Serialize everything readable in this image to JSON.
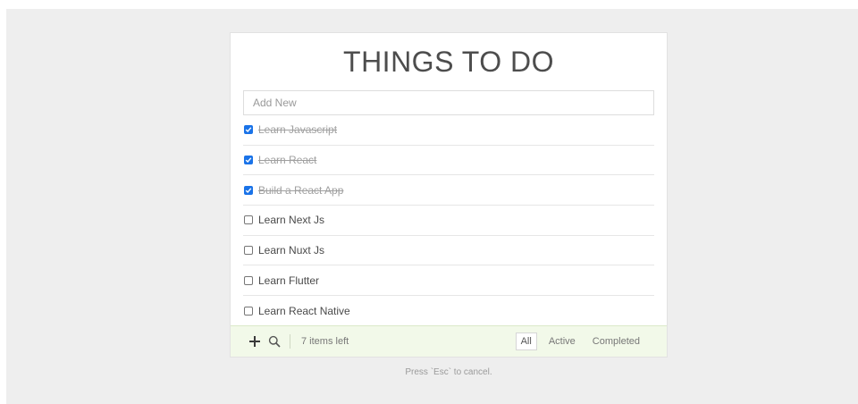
{
  "app": {
    "title": "THINGS TO DO"
  },
  "add_input": {
    "placeholder": "Add New",
    "value": ""
  },
  "todos": [
    {
      "label": "Learn Javascript",
      "completed": true
    },
    {
      "label": "Learn React",
      "completed": true
    },
    {
      "label": "Build a React App",
      "completed": true
    },
    {
      "label": "Learn Next Js",
      "completed": false
    },
    {
      "label": "Learn Nuxt Js",
      "completed": false
    },
    {
      "label": "Learn Flutter",
      "completed": false
    },
    {
      "label": "Learn React Native",
      "completed": false
    }
  ],
  "footer": {
    "items_left": "7 items left",
    "filters": [
      "All",
      "Active",
      "Completed"
    ],
    "active_filter": "All",
    "icons": [
      "add-icon",
      "search-icon"
    ]
  },
  "hint": "Press `Esc` to cancel.",
  "colors": {
    "background": "#eeeeee",
    "footer_bg": "#f2f9e9",
    "checkbox_checked": "#1a73e8",
    "completed_text": "#a0a0a0"
  }
}
